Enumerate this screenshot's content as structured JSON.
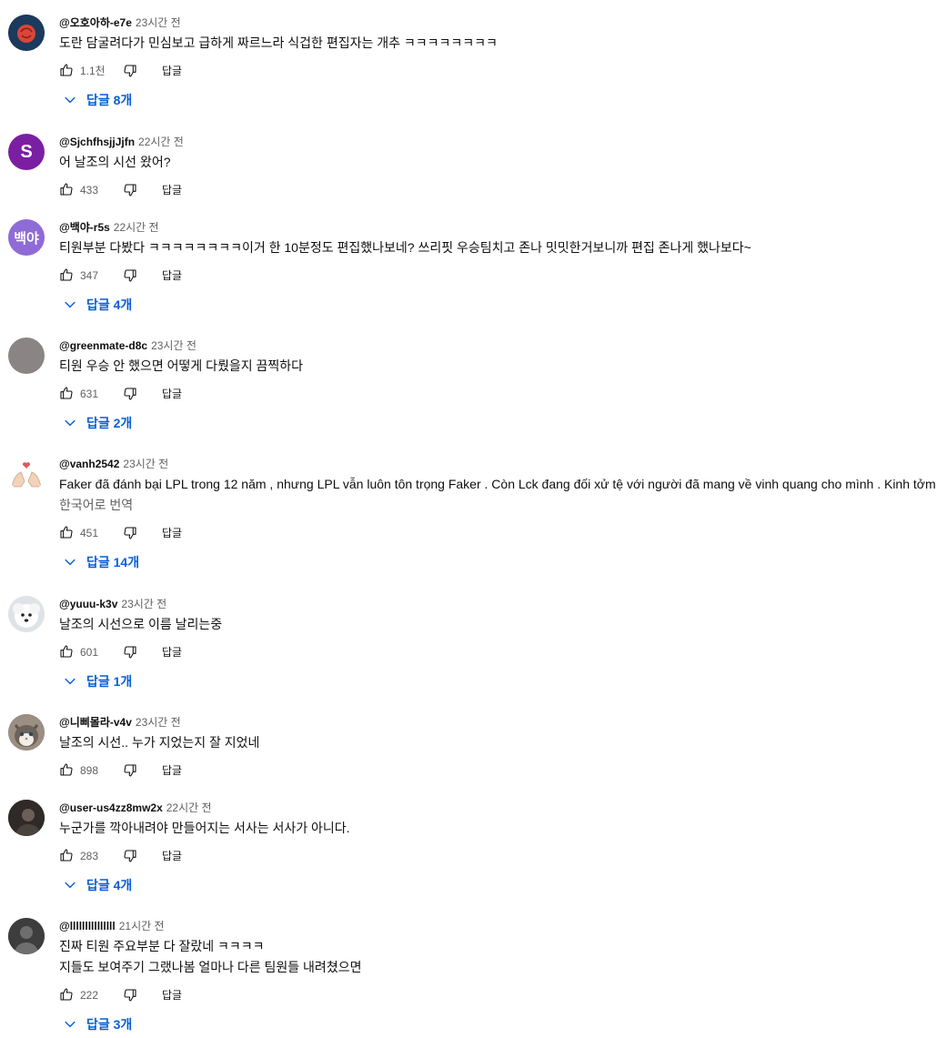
{
  "comments": [
    {
      "author": "@오호아하-e7e",
      "time": "23시간 전",
      "lines": [
        "도란 담굴려다가 민심보고 급하게 짜르느라 식겁한 편집자는 개추 ㅋㅋㅋㅋㅋㅋㅋㅋ"
      ],
      "likes": "1.1천",
      "reply_label": "답글",
      "replies": "답글 8개",
      "avatar": {
        "kind": "rose-icon",
        "bg": "#1b3a5c",
        "fg": "#d9463a"
      }
    },
    {
      "author": "@SjchfhsjjJjfn",
      "time": "22시간 전",
      "lines": [
        "어 날조의 시선 왔어?"
      ],
      "likes": "433",
      "reply_label": "답글",
      "replies": "",
      "avatar": {
        "kind": "letter",
        "letter": "S",
        "bg": "#7b1fa2"
      }
    },
    {
      "author": "@백야-r5s",
      "time": "22시간 전",
      "lines": [
        "티원부분 다봤다 ㅋㅋㅋㅋㅋㅋㅋㅋ이거 한 10분정도 편집했나보네? 쓰리핏 우승팀치고 존나 밋밋한거보니까 편집 존나게 했나보다~"
      ],
      "likes": "347",
      "reply_label": "답글",
      "replies": "답글 4개",
      "avatar": {
        "kind": "letter",
        "letter": "백야",
        "bg": "#8e6bd6"
      }
    },
    {
      "author": "@greenmate-d8c",
      "time": "23시간 전",
      "lines": [
        "티원 우승 안 했으면 어떻게 다뤘을지 끔찍하다"
      ],
      "likes": "631",
      "reply_label": "답글",
      "replies": "답글 2개",
      "avatar": {
        "kind": "plain",
        "bg": "#8a8584"
      }
    },
    {
      "author": "@vanh2542",
      "time": "23시간 전",
      "lines": [
        "Faker đã đánh bại LPL trong 12 năm , nhưng LPL vẫn luôn tôn trọng Faker . Còn Lck đang đối xử tệ với người đã mang về vinh quang cho mình . Kinh tởm"
      ],
      "translate": "한국어로 번역",
      "likes": "451",
      "reply_label": "답글",
      "replies": "답글 14개",
      "avatar": {
        "kind": "hands-heart-icon",
        "bg": "#ffffff",
        "fg": "#f3d2b8",
        "heart": "#e05a5a"
      }
    },
    {
      "author": "@yuuu-k3v",
      "time": "23시간 전",
      "lines": [
        "날조의 시선으로 이름 날리는중"
      ],
      "likes": "601",
      "reply_label": "답글",
      "replies": "답글 1개",
      "avatar": {
        "kind": "dog-icon",
        "bg": "#dfe3e8",
        "fg": "#ffffff"
      }
    },
    {
      "author": "@니삐몰라-v4v",
      "time": "23시간 전",
      "lines": [
        "날조의 시선.. 누가 지었는지 잘 지었네"
      ],
      "likes": "898",
      "reply_label": "답글",
      "replies": "",
      "avatar": {
        "kind": "cat-icon",
        "bg": "#9b8f83",
        "fg": "#f1ede8"
      }
    },
    {
      "author": "@user-us4zz8mw2x",
      "time": "22시간 전",
      "lines": [
        "누군가를 깍아내려야 만들어지는 서사는 서사가 아니다."
      ],
      "likes": "283",
      "reply_label": "답글",
      "replies": "답글 4개",
      "avatar": {
        "kind": "photo-icon",
        "bg": "#2f2a28",
        "fg": "#6b5f57"
      }
    },
    {
      "author": "@lllllllllllllll",
      "time": "21시간 전",
      "lines": [
        "진짜 티원 주요부분 다 잘랐네 ㅋㅋㅋㅋ",
        "지들도 보여주기 그랬나봄 얼마나 다른 팀원들 내려쳤으면"
      ],
      "likes": "222",
      "reply_label": "답글",
      "replies": "답글 3개",
      "avatar": {
        "kind": "default-user-icon",
        "bg": "#3d3d3d",
        "fg": "#6e6e6e"
      }
    }
  ]
}
